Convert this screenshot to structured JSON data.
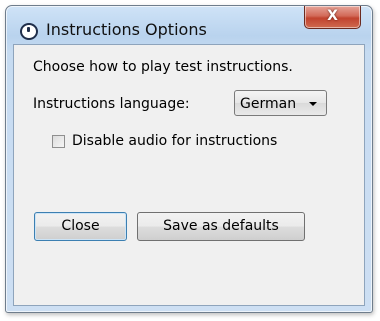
{
  "window": {
    "title": "Instructions Options",
    "close_label": "X",
    "title_icon": "app-info-icon"
  },
  "dialog": {
    "prompt": "Choose how to play test instructions.",
    "language_label": "Instructions language:",
    "language_value": "German",
    "disable_audio_label": "Disable audio for instructions",
    "disable_audio_checked": false
  },
  "buttons": {
    "close": "Close",
    "save_defaults": "Save as defaults"
  }
}
